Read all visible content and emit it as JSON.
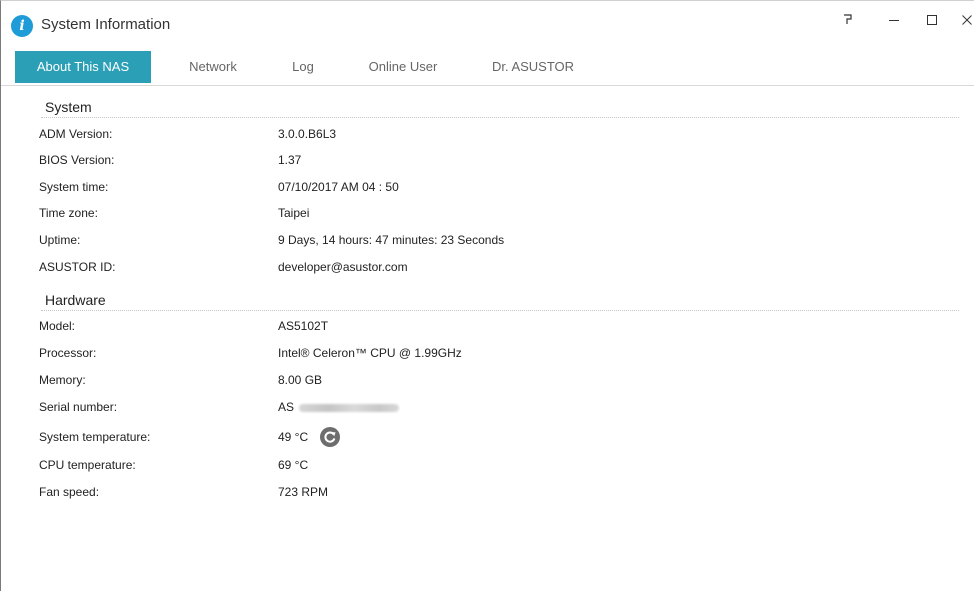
{
  "window": {
    "title": "System Information",
    "controls": {
      "help_icon": "help-icon",
      "minimize_icon": "minimize-icon",
      "maximize_icon": "maximize-icon",
      "close_icon": "close-icon"
    }
  },
  "tabs": [
    {
      "label": "About This NAS",
      "active": true
    },
    {
      "label": "Network",
      "active": false
    },
    {
      "label": "Log",
      "active": false
    },
    {
      "label": "Online User",
      "active": false
    },
    {
      "label": "Dr. ASUSTOR",
      "active": false
    }
  ],
  "system": {
    "title": "System",
    "rows": [
      {
        "label": "ADM Version:",
        "value": "3.0.0.B6L3"
      },
      {
        "label": "BIOS Version:",
        "value": "1.37"
      },
      {
        "label": "System time:",
        "value": "07/10/2017  AM 04 : 50"
      },
      {
        "label": "Time zone:",
        "value": "Taipei"
      },
      {
        "label": "Uptime:",
        "value": "9 Days, 14 hours: 47 minutes: 23 Seconds"
      },
      {
        "label": "ASUSTOR ID:",
        "value": "developer@asustor.com"
      }
    ]
  },
  "hardware": {
    "title": "Hardware",
    "rows": [
      {
        "label": "Model:",
        "value": "AS5102T"
      },
      {
        "label": "Processor:",
        "value": "Intel® Celeron™ CPU @ 1.99GHz"
      },
      {
        "label": "Memory:",
        "value": "8.00 GB"
      },
      {
        "label": "Serial number:",
        "value": "AS"
      },
      {
        "label": "System temperature:",
        "value": "49 °C"
      },
      {
        "label": "CPU temperature:",
        "value": "69 °C"
      },
      {
        "label": "Fan speed:",
        "value": "723 RPM"
      }
    ]
  },
  "colors": {
    "accent": "#2a9fb6",
    "app_icon": "#1f9bd8",
    "refresh_icon": "#6d6d6d"
  }
}
